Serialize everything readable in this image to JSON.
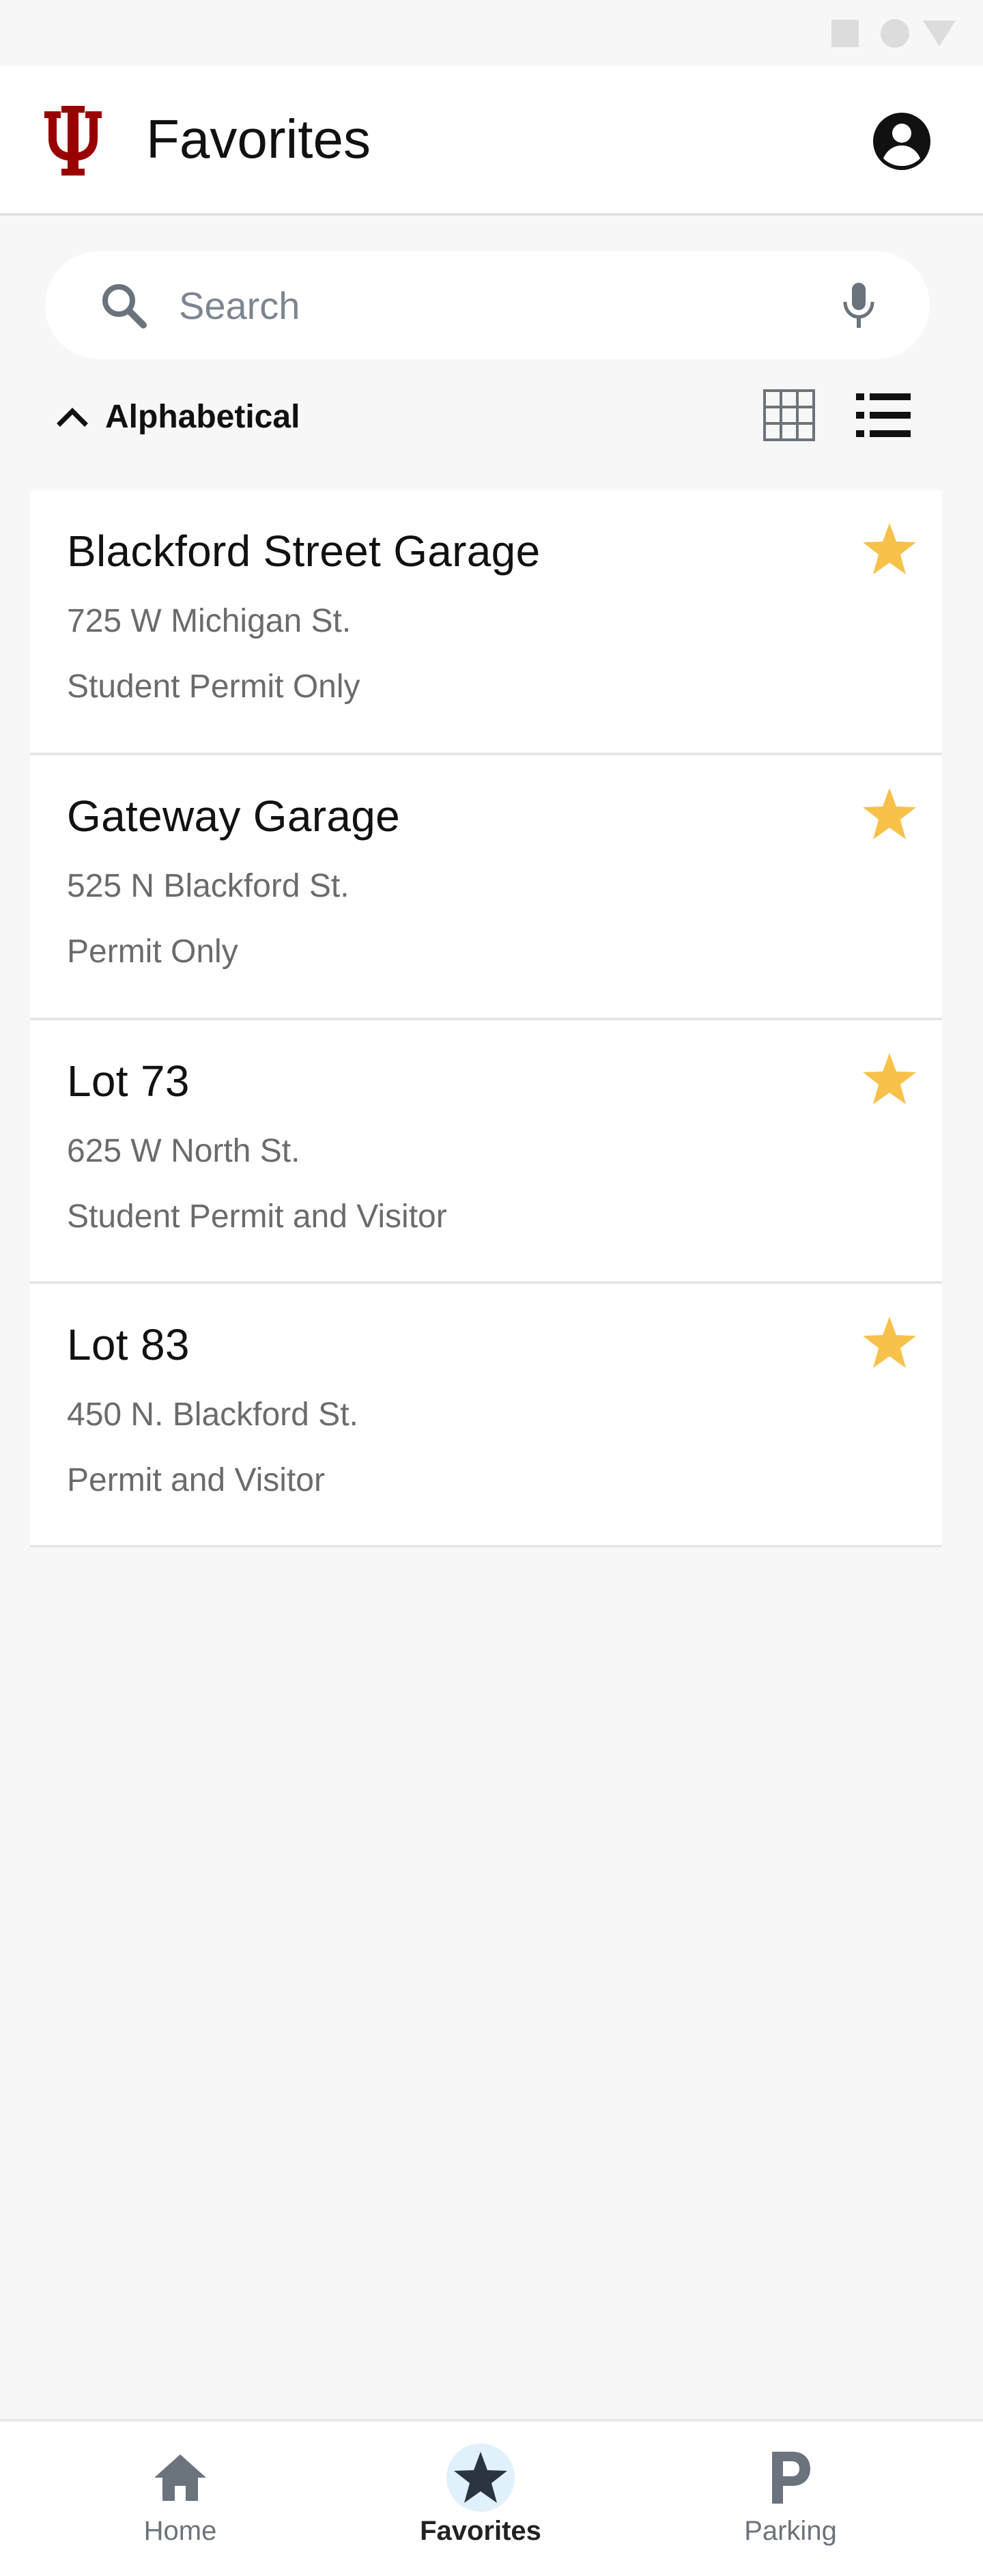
{
  "header": {
    "title": "Favorites"
  },
  "search": {
    "placeholder": "Search",
    "value": ""
  },
  "sort": {
    "label": "Alphabetical",
    "direction": "ascending"
  },
  "view": {
    "selected": "list"
  },
  "favorites": [
    {
      "name": "Blackford Street Garage",
      "address": "725 W Michigan St.",
      "permit": "Student Permit Only",
      "favorited": true
    },
    {
      "name": "Gateway Garage",
      "address": "525 N Blackford St.",
      "permit": "Permit Only",
      "favorited": true
    },
    {
      "name": "Lot 73",
      "address": "625 W North St.",
      "permit": "Student Permit and Visitor",
      "favorited": true
    },
    {
      "name": "Lot 83",
      "address": "450 N. Blackford St.",
      "permit": "Permit and Visitor",
      "favorited": true
    }
  ],
  "nav": {
    "items": [
      {
        "label": "Home",
        "icon": "home-icon"
      },
      {
        "label": "Favorites",
        "icon": "star-icon",
        "active": true
      },
      {
        "label": "Parking",
        "icon": "parking-icon"
      }
    ]
  },
  "colors": {
    "brand": "#990000",
    "star": "#f7c14a",
    "nav_active_bg": "#e1f1fb"
  }
}
